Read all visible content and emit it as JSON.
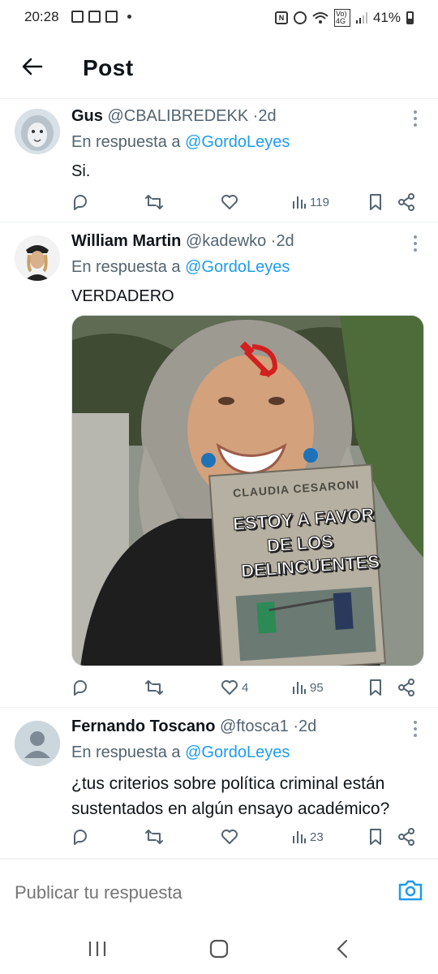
{
  "status_bar": {
    "time": "20:28",
    "battery": "41%",
    "network": "Vo) 4G"
  },
  "header": {
    "title": "Post"
  },
  "tweets": [
    {
      "name": "Gus",
      "handle": "@CBALIBREDEKK",
      "separator": "·",
      "time": "2d",
      "reply_prefix": "En respuesta a",
      "reply_to": "@GordoLeyes",
      "text": "Si.",
      "likes": "",
      "views": "119"
    },
    {
      "name": "William Martin",
      "handle": "@kadewko",
      "separator": "·",
      "time": "2d",
      "reply_prefix": "En respuesta a",
      "reply_to": "@GordoLeyes",
      "text": "VERDADERO",
      "likes": "4",
      "views": "95",
      "media": {
        "book_author": "CLAUDIA CESARONI",
        "book_title_lines": [
          "ESTOY A FAVOR",
          "DE LOS",
          "DELINCUENTES"
        ]
      }
    },
    {
      "name": "Fernando Toscano",
      "handle": "@ftosca1",
      "separator": "·",
      "time": "2d",
      "reply_prefix": "En respuesta a",
      "reply_to": "@GordoLeyes",
      "text": "¿tus criterios sobre política criminal están sustentados en algún ensayo académico?",
      "likes": "",
      "views": "23"
    }
  ],
  "reply_bar": {
    "placeholder": "Publicar tu respuesta"
  },
  "colors": {
    "accent": "#1d9bf0",
    "secondary_text": "#536471",
    "primary_text": "#0f1419"
  }
}
